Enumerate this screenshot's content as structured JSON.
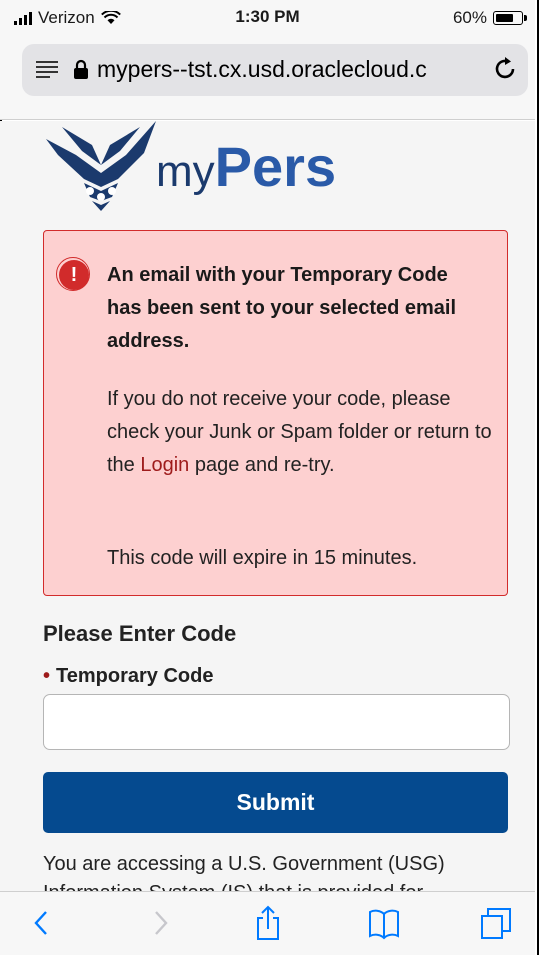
{
  "status_bar": {
    "carrier": "Verizon",
    "time": "1:30 PM",
    "battery": "60%"
  },
  "browser": {
    "url": "mypers--tst.cx.usd.oraclecloud.c"
  },
  "logo": {
    "my": "my",
    "pers": "Pers"
  },
  "alert": {
    "heading": "An email with your Temporary Code has been sent to your selected email address.",
    "body_before_link": "If you do not receive your code, please check your Junk or Spam folder or return to the ",
    "link_text": "Login",
    "body_after_link": " page and re-try.",
    "expire_text": "This code will expire in 15 minutes.",
    "icon_glyph": "!"
  },
  "form": {
    "section_title": "Please Enter Code",
    "required_marker": "•",
    "field_label": "Temporary Code",
    "field_value": "",
    "submit_label": "Submit"
  },
  "disclaimer": "You are accessing a U.S. Government (USG) Information System (IS) that is provided for",
  "toolbar": {
    "icons": [
      "back-icon",
      "forward-icon",
      "share-icon",
      "bookmarks-icon",
      "tabs-icon"
    ]
  },
  "colors": {
    "accent": "#054a8f",
    "alert_bg": "#fdd0d0",
    "alert_border": "#d22b2b",
    "link": "#9e1b1b",
    "ios_blue": "#007aff"
  }
}
